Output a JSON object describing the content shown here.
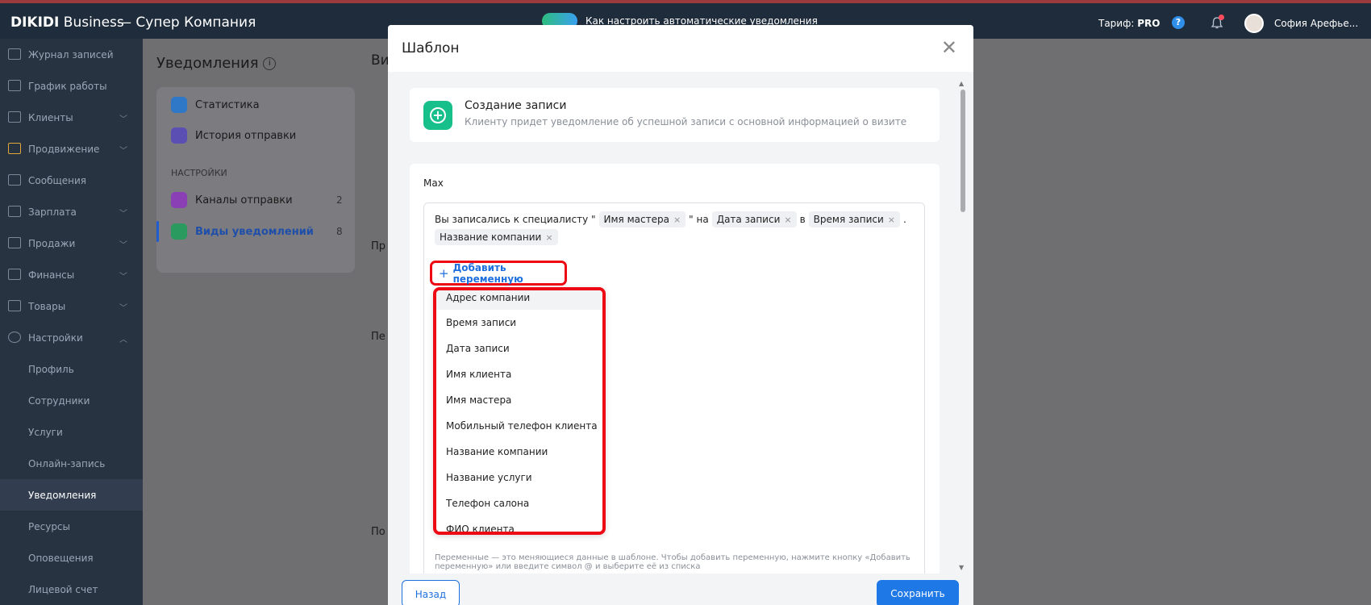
{
  "topbar": {
    "brand_bold": "DIKIDI",
    "brand_rest": " Business",
    "company": "—  Супер Компания",
    "promo": "Как настроить автоматические уведомления",
    "tariff_label": "Тариф: ",
    "tariff_value": "PRO",
    "help": "?",
    "user": "София Арефье..."
  },
  "sidebar": {
    "items": [
      {
        "label": "Журнал записей",
        "icon": "journal-icon"
      },
      {
        "label": "График работы",
        "icon": "calendar-icon"
      },
      {
        "label": "Клиенты",
        "icon": "clients-icon"
      },
      {
        "label": "Продвижение",
        "icon": "rocket-icon"
      },
      {
        "label": "Сообщения",
        "icon": "messages-icon"
      },
      {
        "label": "Зарплата",
        "icon": "salary-icon"
      },
      {
        "label": "Продажи",
        "icon": "sales-icon"
      },
      {
        "label": "Финансы",
        "icon": "finance-icon"
      },
      {
        "label": "Товары",
        "icon": "goods-icon"
      },
      {
        "label": "Настройки",
        "icon": "settings-icon"
      }
    ],
    "sub": [
      "Профиль",
      "Сотрудники",
      "Услуги",
      "Онлайн-запись",
      "Уведомления",
      "Ресурсы",
      "Оповещения",
      "Лицевой счет"
    ]
  },
  "background": {
    "title": "Уведомления",
    "stats": "Статистика",
    "history": "История отправки",
    "section": "НАСТРОЙКИ",
    "channels": "Каналы отправки",
    "channels_count": "2",
    "kinds": "Виды уведомлений",
    "kinds_count": "8",
    "right_heading": "Ви",
    "right_1": "Пр",
    "right_2": "Пе",
    "right_3": "По"
  },
  "modal": {
    "title": "Шаблон",
    "card_title": "Создание записи",
    "card_desc": "Клиенту придет уведомление об успешной записи с основной информацией о визите",
    "channel": "Max",
    "template": {
      "t1": "Вы записались к специалисту \"",
      "chip_master": "Имя мастера",
      "t2": "\" на",
      "chip_date": "Дата записи",
      "t3": "в",
      "chip_time": "Время записи",
      "t4": ".",
      "chip_company": "Название компании",
      "chip_x": "×"
    },
    "add_variable": "Добавить переменную",
    "variables": [
      "Адрес компании",
      "Время записи",
      "Дата записи",
      "Имя клиента",
      "Имя мастера",
      "Мобильный телефон клиента",
      "Название компании",
      "Название услуги",
      "Телефон салона",
      "ФИО клиента"
    ],
    "hint": "Переменные — это меняющиеся данные в шаблоне. Чтобы добавить переменную, нажмите кнопку «Добавить переменную» или введите символ @ и выберите её из списка",
    "back": "Назад",
    "save": "Сохранить"
  },
  "colors": {
    "topbar": "#1f2c3b",
    "sidebar": "#283342",
    "accent": "#1e78e6",
    "highlight": "#ee0a14",
    "badge": "#17c08a"
  }
}
